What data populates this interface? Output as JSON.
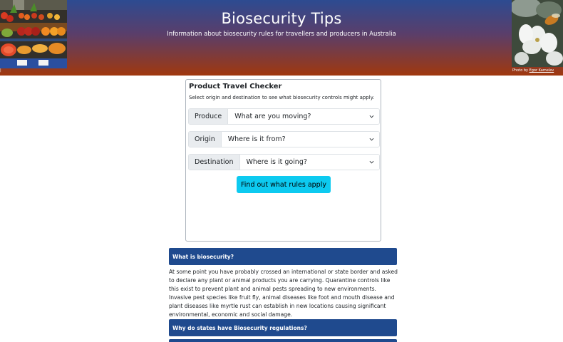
{
  "header": {
    "title": "Biosecurity Tips",
    "subtitle": "Information about biosecurity rules for travellers and producers in Australia",
    "photo_credit_prefix": "Photo by ",
    "photo_credit_author": "Egor Kamelev"
  },
  "checker": {
    "title": "Product Travel Checker",
    "description": "Select origin and destination to see what biosecurity controls might apply.",
    "produce": {
      "label": "Produce",
      "selected": "What are you moving?"
    },
    "origin": {
      "label": "Origin",
      "selected": "Where is it from?"
    },
    "destination": {
      "label": "Destination",
      "selected": "Where is it going?"
    },
    "submit_label": "Find out what rules apply"
  },
  "accordion": [
    {
      "title": "What is biosecurity?",
      "body": "At some point you have probably crossed an international or state border and asked to declare any plant or animal products you are carrying. Quarantine controls like this exist to prevent plant and animal pests spreading to new environments. Invasive pest species like fruit fly, animal diseases like foot and mouth disease and plant diseases like myrtle rust can establish in new locations causing significant environmental, economic and social damage."
    },
    {
      "title": "Why do states have Biosecurity regulations?",
      "body": ""
    },
    {
      "title": "",
      "body": ""
    }
  ],
  "colors": {
    "header_top": "#2d4b91",
    "header_bottom": "#a0380e",
    "accordion_header": "#1f4a8e",
    "button": "#0dcaf0"
  }
}
